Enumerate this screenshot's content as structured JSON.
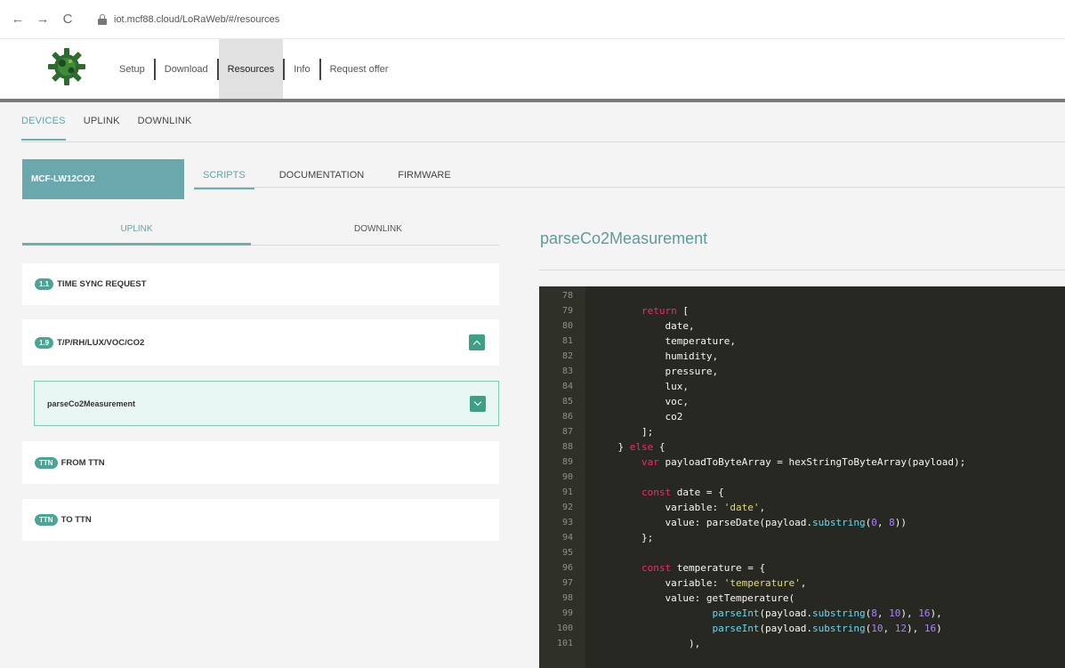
{
  "browser": {
    "back": "←",
    "forward": "→",
    "reload": "C",
    "url": "iot.mcf88.cloud/LoRaWeb/#/resources"
  },
  "site_nav": {
    "items": [
      {
        "label": "Setup",
        "active": false
      },
      {
        "label": "Download",
        "active": false
      },
      {
        "label": "Resources",
        "active": true
      },
      {
        "label": "Info",
        "active": false
      },
      {
        "label": "Request offer",
        "active": false
      }
    ]
  },
  "top_tabs": [
    "DEVICES",
    "UPLINK",
    "DOWNLINK"
  ],
  "device": "MCF-LW12CO2",
  "sub_tabs": [
    "SCRIPTS",
    "DOCUMENTATION",
    "FIRMWARE"
  ],
  "toggle": {
    "uplink": "UPLINK",
    "downlink": "DOWNLINK"
  },
  "cards": [
    {
      "badge": "1.1",
      "label": "TIME SYNC REQUEST"
    },
    {
      "badge": "1.9",
      "label": "T/P/RH/LUX/VOC/CO2"
    },
    {
      "label": "parseCo2Measurement"
    },
    {
      "badge": "TTN",
      "label": "FROM TTN"
    },
    {
      "badge": "TTN",
      "label": "TO TTN"
    }
  ],
  "function_title": "parseCo2Measurement",
  "code": {
    "lines": [
      {
        "n": "78",
        "text": ""
      },
      {
        "n": "79",
        "text": "        return ["
      },
      {
        "n": "80",
        "text": "            date,"
      },
      {
        "n": "81",
        "text": "            temperature,"
      },
      {
        "n": "82",
        "text": "            humidity,"
      },
      {
        "n": "83",
        "text": "            pressure,"
      },
      {
        "n": "84",
        "text": "            lux,"
      },
      {
        "n": "85",
        "text": "            voc,"
      },
      {
        "n": "86",
        "text": "            co2"
      },
      {
        "n": "87",
        "text": "        ];"
      },
      {
        "n": "88",
        "text": "    } else {"
      },
      {
        "n": "89",
        "text": "        var payloadToByteArray = hexStringToByteArray(payload);"
      },
      {
        "n": "90",
        "text": ""
      },
      {
        "n": "91",
        "text": "        const date = {"
      },
      {
        "n": "92",
        "text": "            variable: 'date',"
      },
      {
        "n": "93",
        "text": "            value: parseDate(payload.substring(0, 8))"
      },
      {
        "n": "94",
        "text": "        };"
      },
      {
        "n": "95",
        "text": ""
      },
      {
        "n": "96",
        "text": "        const temperature = {"
      },
      {
        "n": "97",
        "text": "            variable: 'temperature',"
      },
      {
        "n": "98",
        "text": "            value: getTemperature("
      },
      {
        "n": "99",
        "text": "                    parseInt(payload.substring(8, 10), 16),"
      },
      {
        "n": "100",
        "text": "                    parseInt(payload.substring(10, 12), 16)"
      },
      {
        "n": "101",
        "text": "                ),"
      }
    ]
  },
  "colors": {
    "accent": "#6ab0b1",
    "device_box": "#6aa8ad",
    "badge": "#49a595",
    "editor_bg": "#272822"
  }
}
